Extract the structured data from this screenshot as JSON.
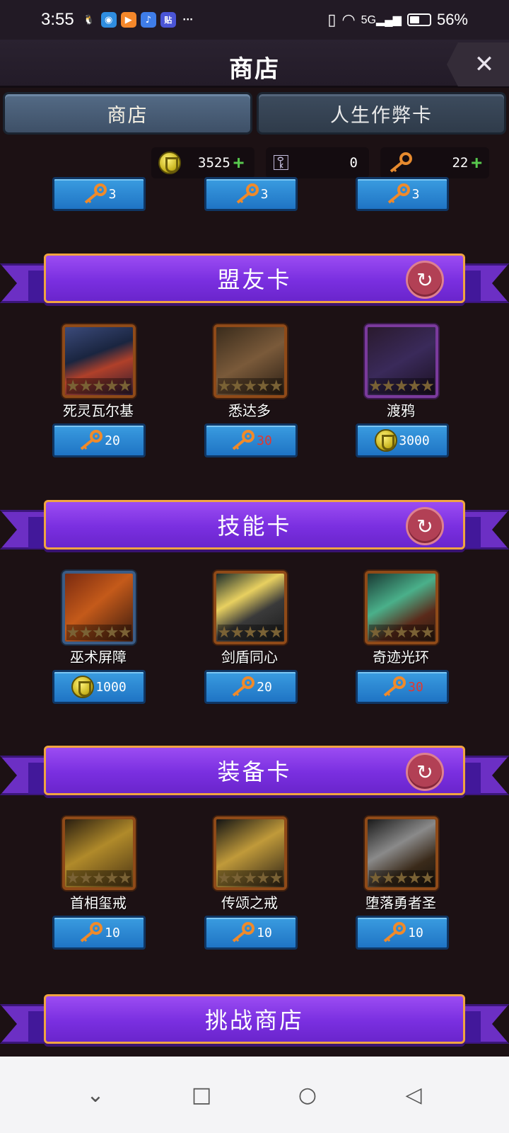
{
  "status_bar": {
    "time": "3:55",
    "battery_text": "56%",
    "battery_level": 0.56,
    "icons": [
      "qq-icon",
      "browser-icon",
      "video-icon",
      "music-icon",
      "tieba-icon",
      "more-icon"
    ],
    "network": "5G"
  },
  "header": {
    "title": "商店",
    "close_label": "✕"
  },
  "tabs": [
    {
      "label": "商店",
      "active": true
    },
    {
      "label": "人生作弊卡",
      "active": false
    }
  ],
  "currency": {
    "coins": "3525",
    "silver_keys": "0",
    "gold_keys": "22",
    "plus": "+"
  },
  "top_row_prices": [
    {
      "value": "3",
      "currency": "key"
    },
    {
      "value": "3",
      "currency": "key"
    },
    {
      "value": "3",
      "currency": "key"
    }
  ],
  "sections": [
    {
      "title": "盟友卡",
      "items": [
        {
          "name": "死灵瓦尔基",
          "price": "20",
          "currency": "key",
          "price_red": false,
          "frame": "orange"
        },
        {
          "name": "悉达多",
          "price": "30",
          "currency": "key",
          "price_red": true,
          "frame": "orange"
        },
        {
          "name": "渡鸦",
          "price": "3000",
          "currency": "coin",
          "price_red": false,
          "frame": "purple"
        }
      ]
    },
    {
      "title": "技能卡",
      "items": [
        {
          "name": "巫术屏障",
          "price": "1000",
          "currency": "coin",
          "price_red": false,
          "frame": "blue"
        },
        {
          "name": "剑盾同心",
          "price": "20",
          "currency": "key",
          "price_red": false,
          "frame": "orange"
        },
        {
          "name": "奇迹光环",
          "price": "30",
          "currency": "key",
          "price_red": true,
          "frame": "orange"
        }
      ]
    },
    {
      "title": "装备卡",
      "items": [
        {
          "name": "首相玺戒",
          "price": "10",
          "currency": "key",
          "price_red": false,
          "frame": "orange"
        },
        {
          "name": "传颂之戒",
          "price": "10",
          "currency": "key",
          "price_red": false,
          "frame": "orange"
        },
        {
          "name": "堕落勇者圣",
          "price": "10",
          "currency": "key",
          "price_red": false,
          "frame": "orange"
        }
      ]
    }
  ],
  "challenge_banner": {
    "title": "挑战商店"
  },
  "navbar": {
    "icons": [
      "chevron-down-icon",
      "square-icon",
      "circle-icon",
      "back-triangle-icon"
    ]
  }
}
